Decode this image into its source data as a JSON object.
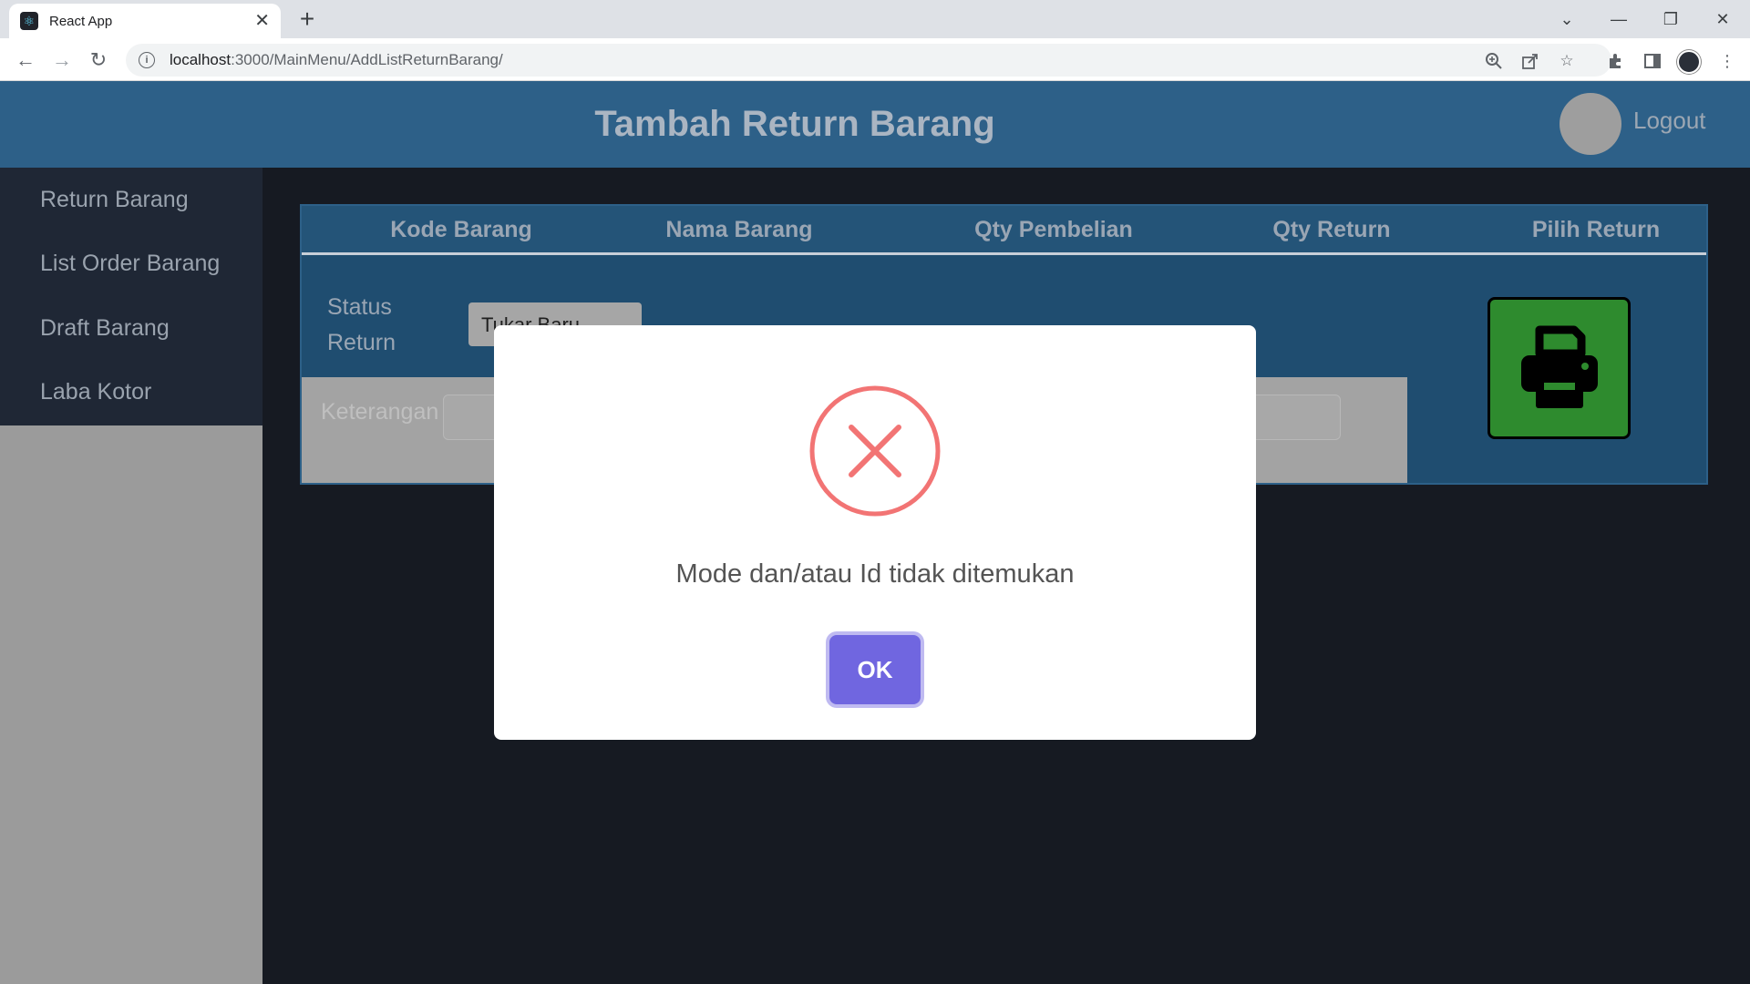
{
  "browser": {
    "tab_title": "React App",
    "tab_close": "✕",
    "new_tab": "+",
    "url_host": "localhost",
    "url_path": ":3000/MainMenu/AddListReturnBarang/",
    "window_controls": {
      "tabsearch": "⌄",
      "minimize": "—",
      "restore": "❐",
      "close": "✕"
    },
    "nav": {
      "back": "←",
      "forward": "→",
      "reload": "↻"
    }
  },
  "header": {
    "title": "Tambah Return Barang",
    "logout_label": "Logout"
  },
  "sidebar": {
    "items": [
      {
        "label": "Return Barang"
      },
      {
        "label": "List Order Barang"
      },
      {
        "label": "Draft Barang"
      },
      {
        "label": "Laba Kotor"
      }
    ]
  },
  "table": {
    "columns": [
      "Kode Barang",
      "Nama Barang",
      "Qty Pembelian",
      "Qty Return",
      "Pilih Return"
    ]
  },
  "form": {
    "status_label": "Status Return",
    "status_value": "Tukar Baru",
    "keterangan_label": "Keterangan"
  },
  "modal": {
    "message": "Mode dan/atau Id tidak ditemukan",
    "ok_label": "OK",
    "icon": "error-icon"
  },
  "colors": {
    "header_bg": "#2d6088",
    "sidebar_bg": "#1f2735",
    "content_bg": "#161a22",
    "print_button_bg": "#2e8b2e",
    "modal_error": "#f27474",
    "ok_button": "#7066e0"
  }
}
